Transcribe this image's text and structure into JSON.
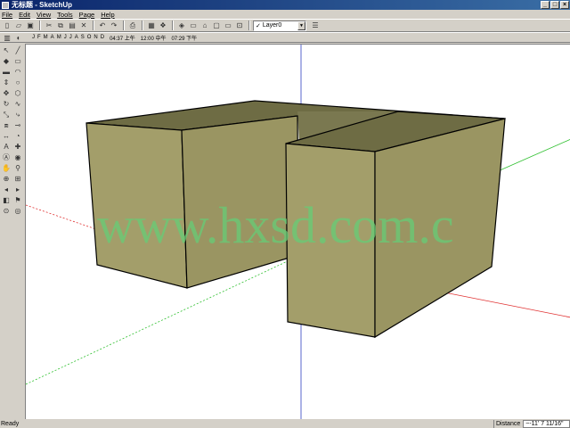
{
  "window": {
    "title": "无标题 - SketchUp"
  },
  "menu": [
    "File",
    "Edit",
    "View",
    "Tools",
    "Page",
    "Help"
  ],
  "toolbar": {
    "layer_label": "Layer0",
    "months": [
      "J",
      "F",
      "M",
      "A",
      "M",
      "J",
      "J",
      "A",
      "S",
      "O",
      "N",
      "D"
    ],
    "time_sunrise": "04:37 上午",
    "time_noon": "12:00 中午",
    "time_sunset": "07:29 下午"
  },
  "watermark": "www.hxsd.com.c",
  "status": {
    "left": "Ready",
    "measure_label": "Distance",
    "measure_value": "~-11' 7 11/16\""
  },
  "colors": {
    "model_face": "#a39e6a",
    "model_top": "#6e6c44",
    "axis_red": "#e03030",
    "axis_green": "#30c030",
    "axis_blue": "#3040c0",
    "watermark": "#66cc77"
  },
  "icons": {
    "toolbar_row1": [
      "new-icon",
      "open-icon",
      "save-icon",
      "cut-icon",
      "copy-icon",
      "paste-icon",
      "erase-icon",
      "undo-icon",
      "redo-icon",
      "print-icon",
      "model-info-icon",
      "components-icon",
      "iso-view-icon",
      "top-view-icon",
      "front-view-icon",
      "right-view-icon",
      "back-view-icon",
      "left-view-icon",
      "layers-icon"
    ],
    "sidebar_tools": [
      "select-icon",
      "line-icon",
      "paint-icon",
      "rectangle-icon",
      "eraser-icon",
      "arc-icon",
      "pushpull-icon",
      "circle-icon",
      "move-icon",
      "polygon-icon",
      "rotate-icon",
      "freehand-icon",
      "scale-icon",
      "followme-icon",
      "offset-icon",
      "tape-icon",
      "dimension-icon",
      "protractor-icon",
      "text-icon",
      "axes-icon",
      "3dtext-icon",
      "orbit-icon",
      "pan-icon",
      "zoom-icon",
      "zoom-window-icon",
      "zoom-extents-icon",
      "previous-icon",
      "next-icon",
      "section-icon",
      "walk-icon",
      "position-camera-icon",
      "lookaround-icon"
    ]
  }
}
